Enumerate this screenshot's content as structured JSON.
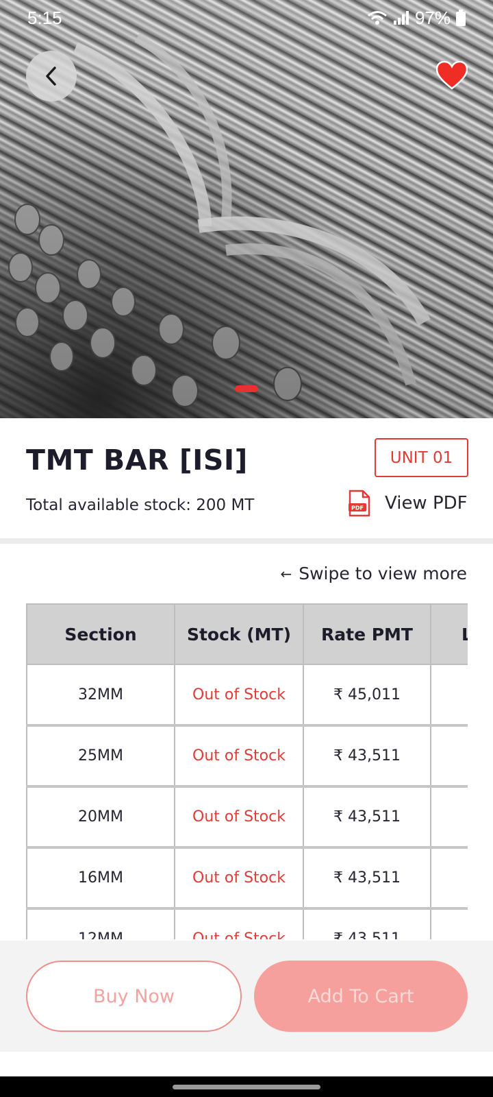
{
  "status_bar": {
    "time": "5:15",
    "battery": "97%"
  },
  "hero": {
    "image_alt": "TMT steel bars",
    "slide_count": 1,
    "active_slide": 1,
    "favorite": true
  },
  "product": {
    "title": "TMT BAR [ISI]",
    "unit_badge": "UNIT 01",
    "stock_text": "Total available stock: 200 MT",
    "pdf_icon_text": "PDF",
    "view_pdf_label": "View PDF"
  },
  "table": {
    "swipe_hint": "Swipe to view more",
    "swipe_arrow": "←",
    "headers": [
      "Section",
      "Stock (MT)",
      "Rate PMT",
      "L"
    ],
    "rows": [
      {
        "section": "32MM",
        "stock": "Out of Stock",
        "rate": "₹ 45,011"
      },
      {
        "section": "25MM",
        "stock": "Out of Stock",
        "rate": "₹ 43,511"
      },
      {
        "section": "20MM",
        "stock": "Out of Stock",
        "rate": "₹ 43,511"
      },
      {
        "section": "16MM",
        "stock": "Out of Stock",
        "rate": "₹ 43,511"
      },
      {
        "section": "12MM",
        "stock": "Out of Stock",
        "rate": "₹ 43,511"
      }
    ]
  },
  "actions": {
    "buy_now": "Buy Now",
    "add_to_cart": "Add To Cart"
  },
  "colors": {
    "accent": "#e23b36",
    "button_disabled_fill": "#f5a09c",
    "button_disabled_text": "#fbd9d7",
    "table_header_bg": "#d1d1d1"
  },
  "icons": {
    "back": "chevron-left-icon",
    "favorite": "heart-icon",
    "pdf": "pdf-file-icon",
    "wifi": "wifi-icon",
    "signal": "signal-icon",
    "battery": "battery-icon"
  }
}
